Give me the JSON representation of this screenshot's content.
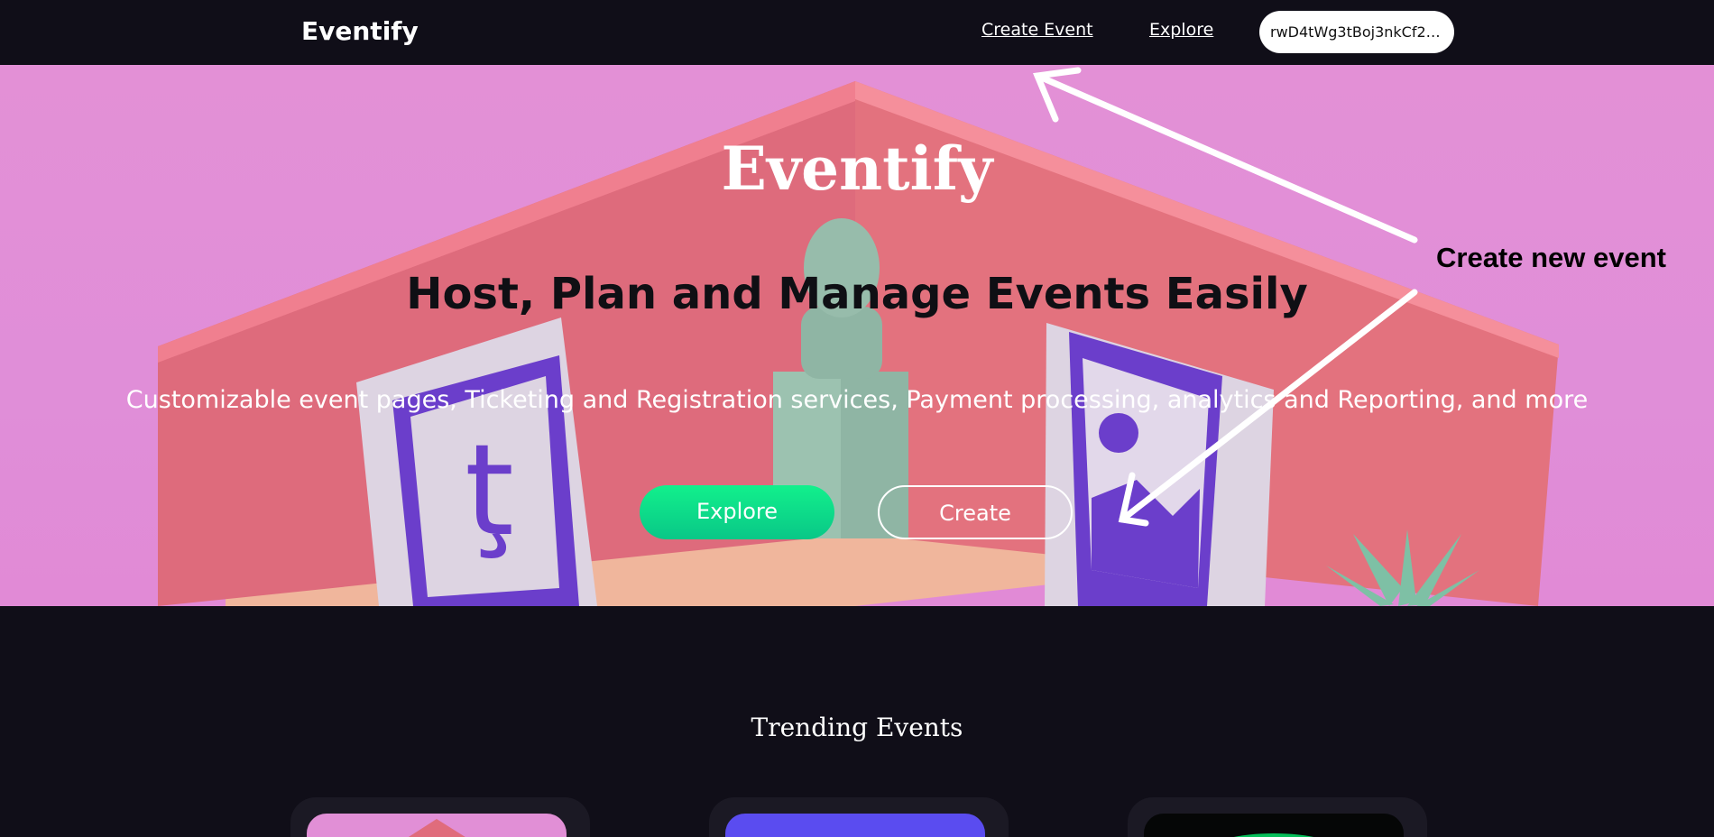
{
  "nav": {
    "brand": "Eventify",
    "links": [
      {
        "label": "Create Event"
      },
      {
        "label": "Explore"
      }
    ],
    "wallet_address": "rwD4tWg3tBoj3nkCf2Z..."
  },
  "hero": {
    "title": "Eventify",
    "heading": "Host, Plan and Manage Events Easily",
    "subheading": "Customizable event pages, Ticketing and Registration services, Payment processing, analytics and Reporting, and more",
    "buttons": {
      "explore": "Explore",
      "create": "Create"
    }
  },
  "annotation": {
    "text": "Create new event"
  },
  "trending": {
    "title": "Trending Events",
    "cards": [
      {
        "thumb": "pink-room-thumbnail"
      },
      {
        "thumb": "purple-blue-thumbnail"
      },
      {
        "thumb": "dark-green-thumbnail"
      }
    ]
  },
  "colors": {
    "nav_bg": "#100e18",
    "hero_bg": "#e08ed8",
    "accent_green": "#09d98a",
    "room_wall": "#e66a7e",
    "tezos_purple": "#6a3cc8"
  }
}
